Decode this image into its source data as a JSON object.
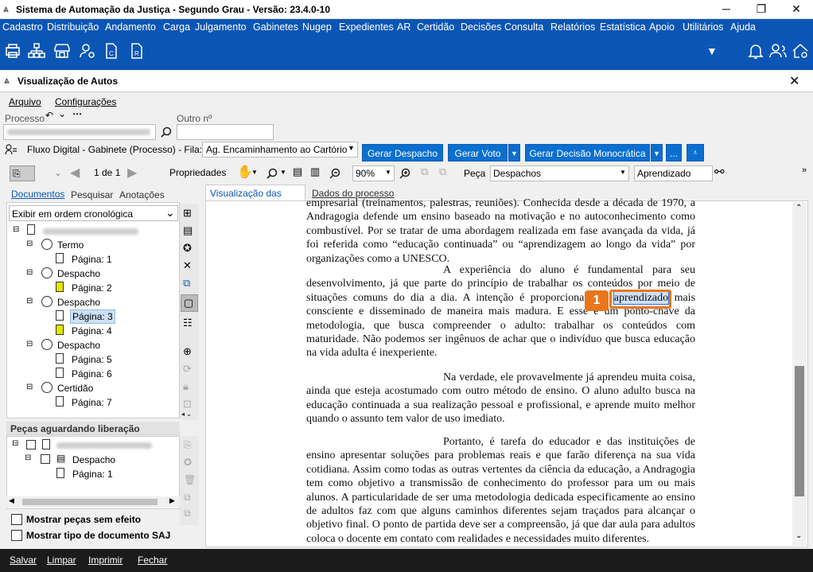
{
  "window": {
    "title": "Sistema de Automação da Justiça - Segundo Grau - Versão: 23.4.0-10"
  },
  "menu": [
    "Cadastro",
    "Distribuição",
    "Andamento",
    "Carga",
    "Julgamento",
    "Gabinetes",
    "Nugep",
    "Expedientes",
    "AR",
    "Certidão",
    "Decisões",
    "Consulta",
    "Relatórios",
    "Estatística",
    "Apoio",
    "Utilitários",
    "Ajuda"
  ],
  "subwindow": {
    "title": "Visualização de Autos"
  },
  "submenu": {
    "arquivo": "Arquivo",
    "config": "Configurações"
  },
  "processo": {
    "label": "Processo",
    "outro_label": "Outro nº",
    "value_blurred": "0001066-46.2021.8.26.0000 - 20000"
  },
  "fluxo": {
    "label": "Fluxo Digital - Gabinete (Processo) - Fila:",
    "fila_value": "Ag. Encaminhamento ao Cartório"
  },
  "actions": {
    "despacho": "Gerar Despacho",
    "voto": "Gerar Voto",
    "decisao": "Gerar Decisão Monocrática",
    "more": "..."
  },
  "viewer": {
    "page_label": "1 de 1",
    "properties": "Propriedades",
    "zoom": "90%",
    "peca_label": "Peça",
    "peca_value": "Despachos",
    "search_value": "Aprendizado"
  },
  "left_tabs": {
    "documentos": "Documentos",
    "pesquisar": "Pesquisar",
    "anotacoes": "Anotações"
  },
  "order_select": "Exibir em ordem cronológica",
  "tree": [
    {
      "label": "Termo",
      "pages": [
        "Página: 1"
      ]
    },
    {
      "label": "Despacho",
      "pages": [
        "Página: 2"
      ]
    },
    {
      "label": "Despacho",
      "pages": [
        "Página: 3",
        "Página: 4"
      ]
    },
    {
      "label": "Despacho",
      "pages": [
        "Página: 5",
        "Página: 6"
      ]
    },
    {
      "label": "Certidão",
      "pages": [
        "Página: 7"
      ]
    }
  ],
  "pending": {
    "title": "Peças aguardando liberação",
    "item": "Despacho",
    "page": "Página: 1"
  },
  "checks": {
    "sem_efeito": "Mostrar peças sem efeito",
    "tipo_doc": "Mostrar tipo de documento SAJ"
  },
  "doc_tabs": {
    "visualizacao": "Visualização das peças",
    "dados": "Dados do processo"
  },
  "callout": "1",
  "text": {
    "p1": "empresarial (treinamentos, palestras, reuniões). Conhecida desde a década de 1970, a Andragogia defende um ensino baseado na motivação e no autoconhecimento como combustível. Por se tratar de uma abordagem realizada em fase avançada da vida, já foi referida como “educação continuada” ou “aprendizagem ao longo da vida” por organizações como a UNESCO.",
    "p2a": "A experiência do aluno é fundamental para seu desenvolvimento, já que parte do princípio de trabalhar os conteúdos por meio de situações comuns do dia a dia. A intenção é proporcionar um",
    "p2hl": "aprendizado",
    "p2b": "mais consciente e disseminado de maneira mais madura.  E esse é um ponto-chave da metodologia, que busca compreender o adulto: trabalhar os conteúdos com maturidade. Não podemos ser ingênuos de achar que o indivíduo que busca educação na vida adulta é inexperiente.",
    "p3": "Na verdade, ele provavelmente já aprendeu muita coisa, ainda que esteja acostumado com outro método de ensino. O aluno adulto busca na educação continuada a sua realização pessoal e profissional, e aprende muito melhor quando o assunto tem valor de uso imediato.",
    "p4": "Portanto, é tarefa do educador e das instituições de ensino apresentar soluções para problemas reais e que farão diferença na sua vida cotidiana. Assim como todas as outras vertentes da ciência da educação, a Andragogia tem como objetivo a transmissão de conhecimento do professor para um ou mais alunos. A particularidade de ser uma metodologia dedicada especificamente ao ensino de adultos faz com que alguns caminhos diferentes sejam traçados para alcançar o objetivo final. O ponto de partida deve ser a compreensão, já que dar aula para adultos coloca o docente em contato com realidades e necessidades muito diferentes."
  },
  "footer": {
    "salvar": "Salvar",
    "limpar": "Limpar",
    "imprimir": "Imprimir",
    "fechar": "Fechar"
  }
}
